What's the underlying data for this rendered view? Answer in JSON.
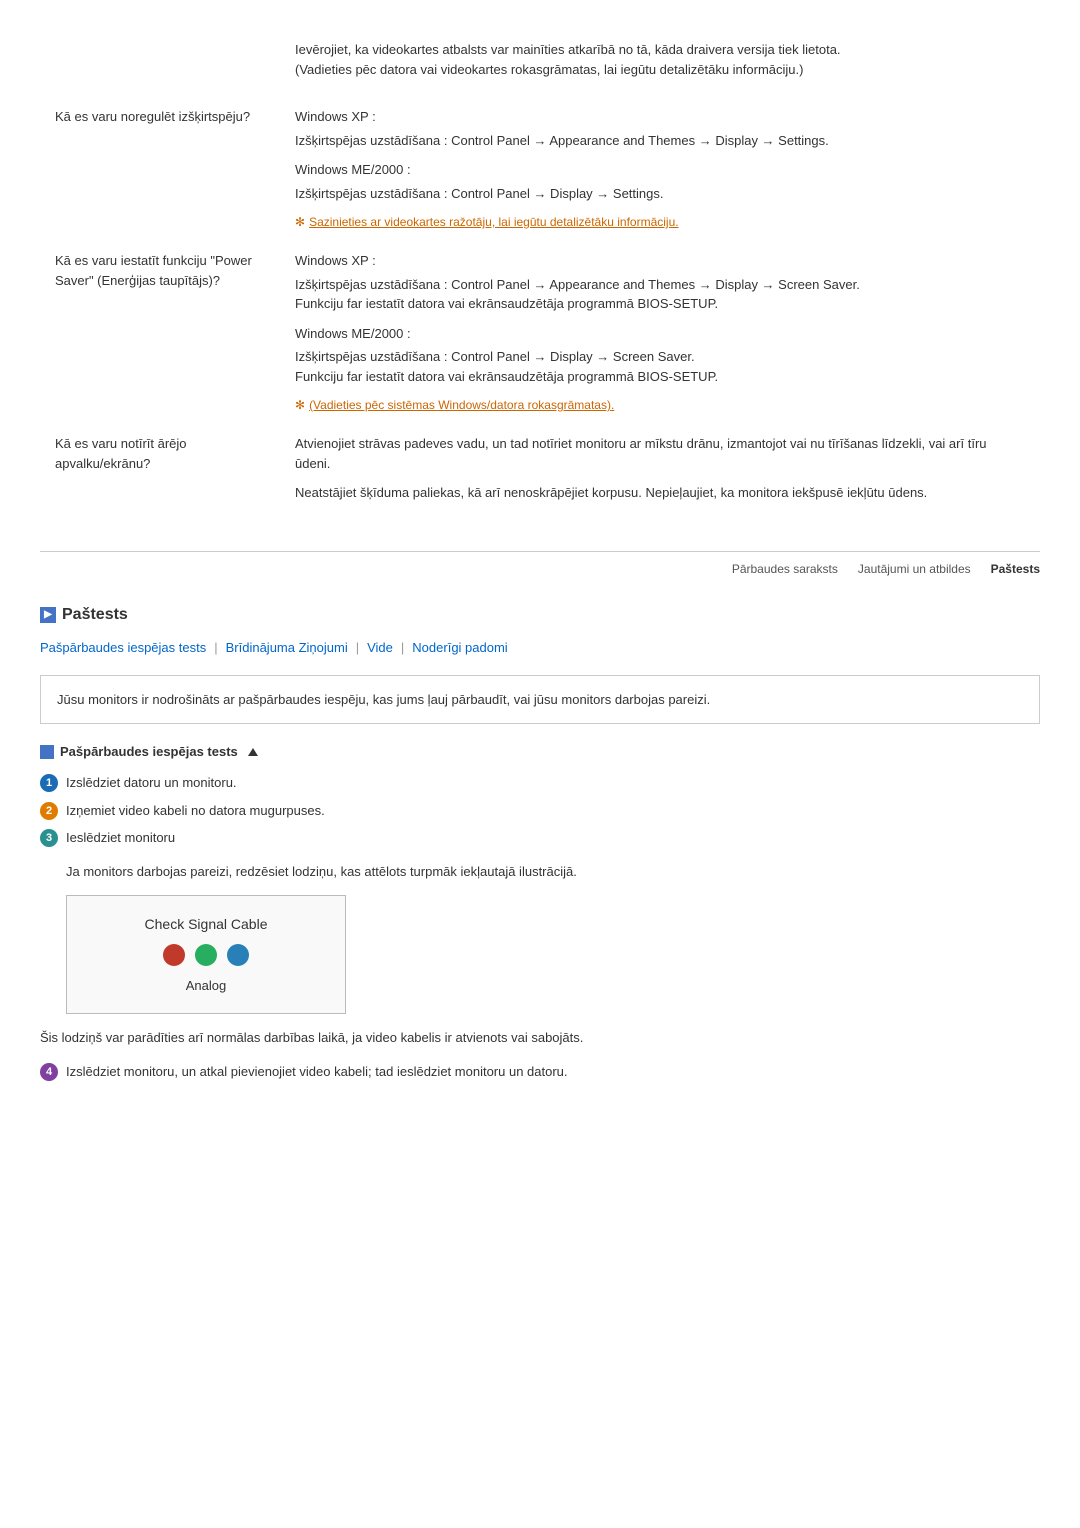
{
  "faq": {
    "rows": [
      {
        "question": "",
        "answer_blocks": [
          {
            "type": "text",
            "content": "Ievērojiet, ka videokartes atbalsts var mainīties atkarībā no tā, kāda draivera versija tiek lietota.\n(Vadieties pēc datora vai videokartes rokasgrāmatas, lai iegūtu detalizētāku informāciju.)"
          }
        ]
      },
      {
        "question": "Kā es varu noregulēt izšķirtspēju?",
        "answer_blocks": [
          {
            "type": "section",
            "title": "Windows XP :",
            "content": "Izšķirtspējas uzstādīšana : Control Panel → Appearance and Themes → Display → Settings."
          },
          {
            "type": "section",
            "title": "Windows ME/2000 :",
            "content": "Izšķirtspējas uzstādīšana : Control Panel → Display → Settings."
          },
          {
            "type": "note",
            "content": "Sazinieties ar videokartes ražotāju, lai iegūtu detalizētāku informāciju."
          }
        ]
      },
      {
        "question": "Kā es varu iestatīt funkciju \"Power Saver\" (Enerģijas taupītājs)?",
        "answer_blocks": [
          {
            "type": "section",
            "title": "Windows XP :",
            "content": "Izšķirtspējas uzstādīšana : Control Panel → Appearance and Themes → Display → Screen Saver.\nFunkciju far iestatīt datora vai ekrānsaudzētāja programmā BIOS-SETUP."
          },
          {
            "type": "section",
            "title": "Windows ME/2000 :",
            "content": "Izšķirtspējas uzstādīšana : Control Panel → Display → Screen Saver.\nFunkciju far iestatīt datora vai ekrānsaudzētāja programmā BIOS-SETUP."
          },
          {
            "type": "note",
            "content": "(Vadieties pēc sistēmas Windows/datora rokasgrāmatas)."
          }
        ]
      },
      {
        "question": "Kā es varu notīrīt ārējo apvalku/ekrānu?",
        "answer_blocks": [
          {
            "type": "text",
            "content": "Atvienojiet strāvas padeves vadu, un tad notīriet monitoru ar mīkstu drānu, izmantojot vai nu tīrīšanas līdzekli, vai arī tīru ūdeni."
          },
          {
            "type": "text",
            "content": "Neatstājiet šķīduma paliekas, kā arī nenoskrāpējiet korpusu. Nepieļaujiet, ka monitora iekšpusē iekļūtu ūdens."
          }
        ]
      }
    ]
  },
  "nav": {
    "items": [
      {
        "label": "Pārbaudes saraksts",
        "active": false
      },
      {
        "label": "Jautājumi un atbildes",
        "active": false
      },
      {
        "label": "Paštests",
        "active": true
      }
    ]
  },
  "pastests": {
    "heading": "Paštests",
    "sub_links": [
      {
        "label": "Pašpārbaudes iespējas tests"
      },
      {
        "label": "Brīdinājuma Ziņojumi"
      },
      {
        "label": "Vide"
      },
      {
        "label": "Noderīgi padomi"
      }
    ],
    "info_box": "Jūsu monitors ir nodrošināts ar pašpārbaudes iespēju, kas jums ļauj pārbaudīt, vai jūsu monitors darbojas pareizi.",
    "subsection_title": "Pašpārbaudes iespējas tests",
    "steps": [
      {
        "num": "1",
        "color": "blue",
        "text": "Izslēdziet datoru un monitoru."
      },
      {
        "num": "2",
        "color": "orange",
        "text": "Izņemiet video kabeli no datora mugurpuses."
      },
      {
        "num": "3",
        "color": "teal",
        "text": "Ieslēdziet monitoru"
      }
    ],
    "step3_note": "Ja monitors darbojas pareizi, redzēsiet lodziņu, kas attēlots turpmāk iekļautajā ilustrācijā.",
    "signal_box": {
      "title": "Check Signal Cable",
      "type_label": "Analog"
    },
    "note_text": "Šis lodziņš var parādīties arī normālas darbības laikā, ja video kabelis ir atvienots vai sabojāts.",
    "step4": {
      "num": "4",
      "color": "purple",
      "text": "Izslēdziet monitoru, un atkal pievienojiet video kabeli; tad ieslēdziet monitoru un datoru."
    }
  }
}
